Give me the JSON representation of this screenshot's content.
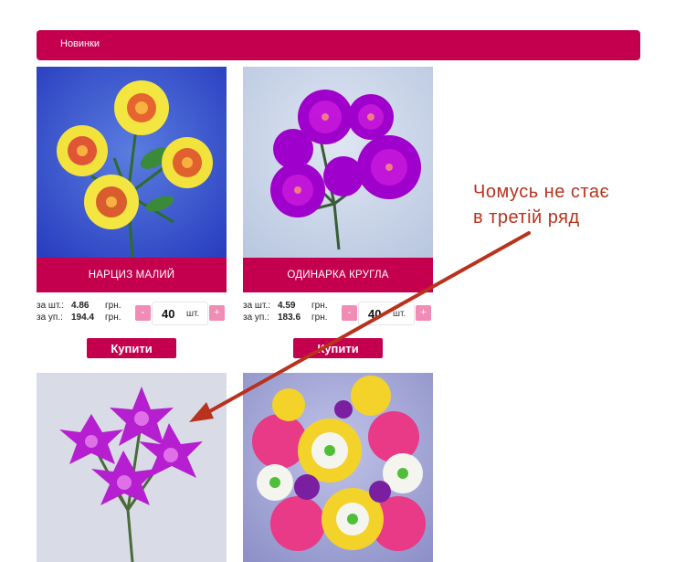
{
  "section": {
    "title": "Новинки"
  },
  "products": [
    {
      "name": "НАРЦИЗ МАЛИЙ",
      "price_unit_label": "за шт.:",
      "price_unit": "4.86",
      "price_pack_label": "за уп.:",
      "price_pack": "194.4",
      "currency": "грн.",
      "quantity": "40",
      "qty_unit": "шт.",
      "minus": "-",
      "plus": "+",
      "buy_label": "Купити"
    },
    {
      "name": "ОДИНАРКА КРУГЛА",
      "price_unit_label": "за шт.:",
      "price_unit": "4.59",
      "price_pack_label": "за уп.:",
      "price_pack": "183.6",
      "currency": "грн.",
      "quantity": "40",
      "qty_unit": "шт.",
      "minus": "-",
      "plus": "+",
      "buy_label": "Купити"
    }
  ],
  "annotation": {
    "line1": "Чомусь не стає",
    "line2": "в третій ряд"
  },
  "colors": {
    "accent": "#c4004e",
    "qty_button": "#f08cb5",
    "annotation": "#b8321d"
  }
}
